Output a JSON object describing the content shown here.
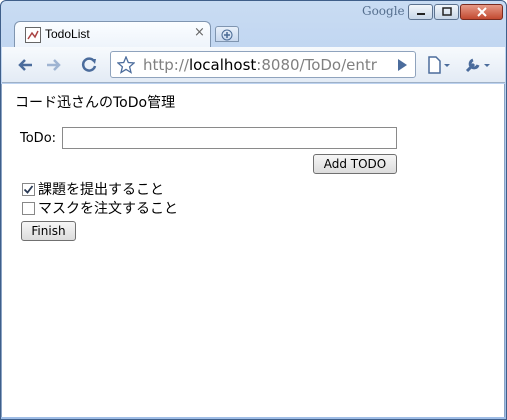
{
  "browser": {
    "brand": "Google",
    "tab_title": "TodoList",
    "address_scheme": "http://",
    "address_host": "localhost",
    "address_rest": ":8080/ToDo/entr",
    "icons": [
      "back-icon",
      "forward-icon",
      "reload-icon",
      "star-icon",
      "go-icon",
      "page-menu-icon",
      "wrench-icon",
      "close-icon",
      "new-tab-icon",
      "favicon"
    ]
  },
  "page": {
    "heading": "コード迅さんのToDo管理",
    "todo_label": "ToDo:",
    "todo_input_value": "",
    "add_button": "Add TODO",
    "items": [
      {
        "label": "課題を提出すること",
        "checked": true
      },
      {
        "label": "マスクを注文すること",
        "checked": false
      }
    ],
    "finish_button": "Finish"
  },
  "colors": {
    "frame": "#aec8ec",
    "accent": "#3f5f8a"
  }
}
